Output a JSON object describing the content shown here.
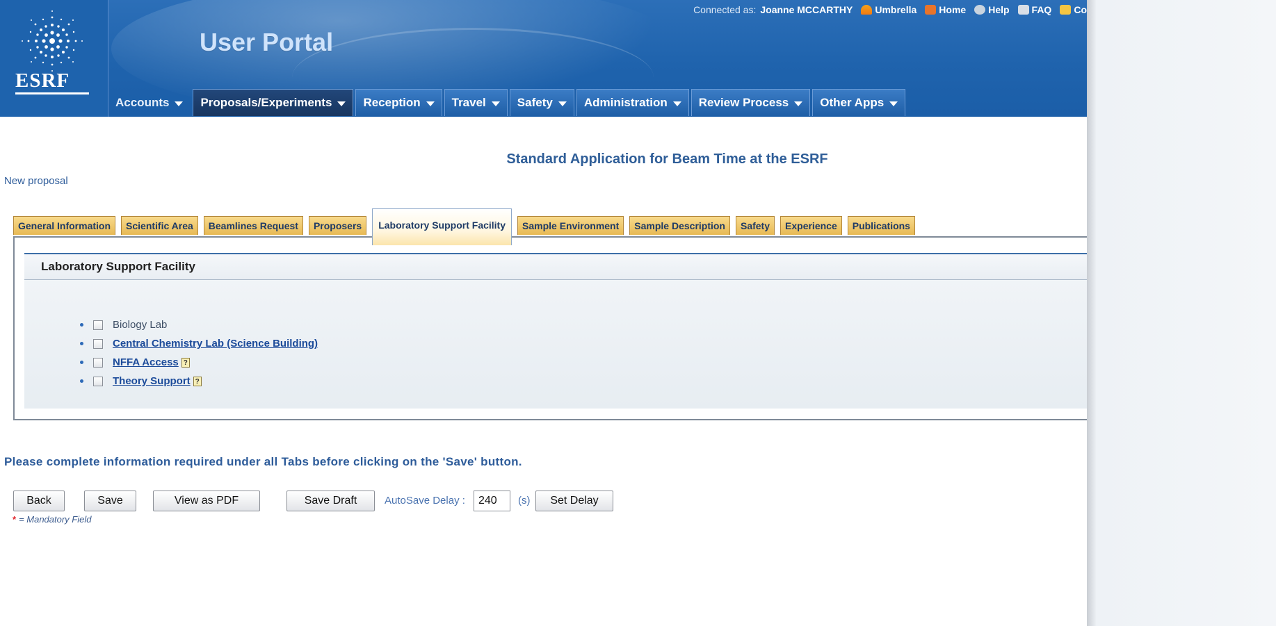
{
  "header": {
    "logo_text": "ESRF",
    "portal_title": "User Portal",
    "connected_prefix": "Connected as:",
    "user_name": "Joanne MCCARTHY",
    "top_links": [
      "Umbrella",
      "Home",
      "Help",
      "FAQ",
      "Co"
    ]
  },
  "nav": {
    "items": [
      {
        "label": "Accounts"
      },
      {
        "label": "Proposals/Experiments"
      },
      {
        "label": "Reception"
      },
      {
        "label": "Travel"
      },
      {
        "label": "Safety"
      },
      {
        "label": "Administration"
      },
      {
        "label": "Review Process"
      },
      {
        "label": "Other Apps"
      }
    ]
  },
  "page": {
    "form_title": "Standard Application for Beam Time at the ESRF",
    "new_proposal": "New proposal"
  },
  "tabs": [
    {
      "label": "General Information"
    },
    {
      "label": "Scientific Area"
    },
    {
      "label": "Beamlines Request"
    },
    {
      "label": "Proposers"
    },
    {
      "label": "Laboratory Support Facility"
    },
    {
      "label": "Sample Environment"
    },
    {
      "label": "Sample Description"
    },
    {
      "label": "Safety"
    },
    {
      "label": "Experience"
    },
    {
      "label": "Publications"
    }
  ],
  "section": {
    "title": "Laboratory Support Facility",
    "items": [
      {
        "label": "Biology Lab"
      },
      {
        "label": "Central Chemistry Lab (Science Building)"
      },
      {
        "label": "NFFA Access"
      },
      {
        "label": "Theory Support"
      }
    ],
    "help_glyph": "?"
  },
  "footer": {
    "notice": "Please complete information required under all Tabs before clicking on the 'Save' button.",
    "back_label": "Back",
    "save_label": "Save",
    "pdf_label": "View as PDF",
    "draft_label": "Save Draft",
    "autosave_label": "AutoSave Delay :",
    "autosave_value": "240",
    "unit": "(s)",
    "set_delay_label": "Set Delay",
    "mandatory_star": "*",
    "mandatory_text": "= Mandatory Field"
  },
  "colors": {
    "header_blue": "#1f63ad",
    "tab_gold": "#e7b954",
    "link_blue": "#1c4b9a"
  }
}
